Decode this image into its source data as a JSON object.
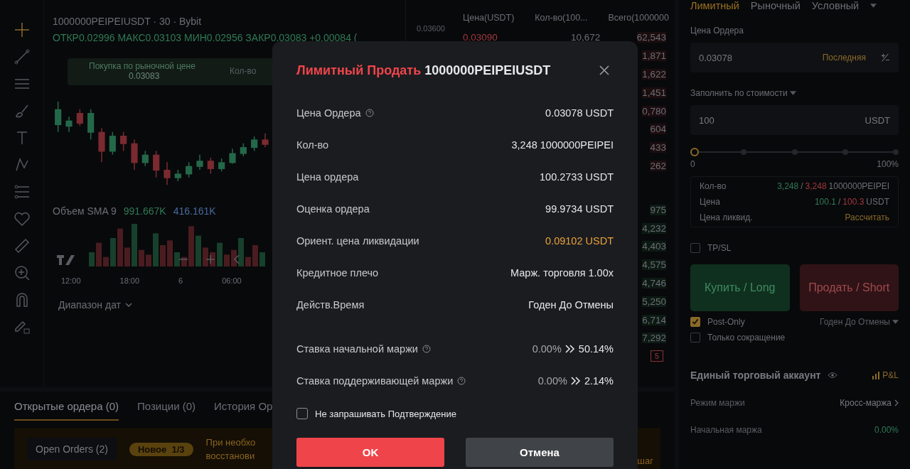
{
  "chart": {
    "legend_title": "1000000PEIPEIUSDT · 30 · Bybit",
    "ohlc": "ОТКР0.02996  МАКС0.03103  МИН0.02956  ЗАКР0.03083  +0.00084 (",
    "tooltip": {
      "label": "Покупка по рыночной цене",
      "price": "0.03083",
      "qty_label": "Кол-во"
    },
    "price_label": "0.03600",
    "volume_label": "Объем SMA 9",
    "volume_values": [
      "991.667K",
      "416.161K"
    ],
    "time_labels": [
      "12:00",
      "18:00",
      "6",
      "06:00"
    ],
    "date_range": "Диапазон дат"
  },
  "orderbook": {
    "columns": [
      "Цена(USDT)",
      "Кол-во(100...",
      "Всего(1000000"
    ],
    "rows": [
      {
        "kind": "ask",
        "price": "0.03090",
        "qty": "10,672",
        "total": "62,543"
      },
      {
        "kind": "ask",
        "total": "1,871"
      },
      {
        "kind": "ask",
        "total": "1,622"
      },
      {
        "kind": "ask",
        "total": "1,451"
      },
      {
        "kind": "ask",
        "total": "0,780"
      },
      {
        "kind": "ask",
        "total": "604"
      },
      {
        "kind": "ask",
        "total": "433"
      },
      {
        "kind": "ask",
        "total": "262"
      },
      {
        "kind": "bid",
        "total": "975"
      },
      {
        "kind": "bid",
        "total": "4,232"
      },
      {
        "kind": "bid",
        "total": "4,403"
      },
      {
        "kind": "bid",
        "total": "4,575"
      },
      {
        "kind": "bid",
        "total": "4,746"
      },
      {
        "kind": "bid",
        "total": "5,250"
      },
      {
        "kind": "bid",
        "total": "6,714"
      },
      {
        "kind": "bid",
        "total": "7,292"
      }
    ],
    "footer_badge": "5"
  },
  "bottom": {
    "tabs": [
      {
        "label": "Открытые ордера (0)",
        "selected": true
      },
      {
        "label": "Позиции (0)",
        "selected": false
      },
      {
        "label": "История Ор",
        "selected": false
      }
    ],
    "banner": {
      "chip": "Open Orders (2)",
      "badge": "Новое  1/3",
      "lines": [
        "При необхо",
        "восстанови"
      ],
      "tail": "шаг"
    }
  },
  "order_form": {
    "tabs": [
      {
        "label": "Лимитный",
        "selected": true
      },
      {
        "label": "Рыночный",
        "selected": false
      },
      {
        "label": "Условный",
        "selected": false
      }
    ],
    "price_label": "Цена Ордера",
    "price_value": "0.03078",
    "price_hint": "Последняя",
    "amount_label": "Заполнить по стоимости",
    "amount_value": "100",
    "amount_unit": "USDT",
    "slider": {
      "level": 0,
      "min_label": "0",
      "max_label": "100%"
    },
    "summary": [
      {
        "label": "Кол-во",
        "buy": "3,248",
        "separator": "/",
        "sell": "3,248",
        "unit": "1000000PEIPEI"
      },
      {
        "label": "Цена",
        "buy": "100.1",
        "separator": "/",
        "sell": "100.3",
        "unit": "USDT"
      },
      {
        "label": "Цена ликвид.",
        "action": "Рассчитать"
      }
    ],
    "tpsl": {
      "label": "TP/SL",
      "checked": false
    },
    "buy_button": "Купить / Long",
    "sell_button": "Продать / Short",
    "options": [
      {
        "label": "Post-Only",
        "checked": true
      },
      {
        "label": "Только сокращение",
        "checked": false
      }
    ],
    "tif": "Годен До Отмены",
    "account": {
      "title": "Единый торговый аккаунт",
      "pnl": "P&L",
      "rows": [
        {
          "label": "Режим маржи",
          "value": "Кросс-маржа"
        },
        {
          "label": "Начальная маржа",
          "value": "0.00%"
        }
      ]
    }
  },
  "modal": {
    "title_action": "Лимитный Продать",
    "title_symbol": "1000000PEIPEIUSDT",
    "rows": [
      {
        "label": "Цена Ордера",
        "help": true,
        "value": "0.03078 USDT",
        "highlight": false
      },
      {
        "label": "Кол-во",
        "help": false,
        "value": "3,248 1000000PEIPEI",
        "highlight": false
      },
      {
        "label": "Цена ордера",
        "help": false,
        "value": "100.2733 USDT",
        "highlight": false
      },
      {
        "label": "Оценка ордера",
        "help": false,
        "value": "99.9734 USDT",
        "highlight": false
      },
      {
        "label": "Ориент. цена ликвидации",
        "help": false,
        "value": "0.09102 USDT",
        "highlight": true
      },
      {
        "label": "Кредитное плечо",
        "help": false,
        "value": "Марж. торговля 1.00x",
        "highlight": false
      },
      {
        "label": "Действ.Время",
        "help": false,
        "value": "Годен До Отмены",
        "highlight": false
      }
    ],
    "margin_rows": [
      {
        "label": "Ставка начальной маржи",
        "help": true,
        "from": "0.00%",
        "to": "50.14%"
      },
      {
        "label": "Ставка поддерживающей маржи",
        "help": true,
        "from": "0.00%",
        "to": "2.14%"
      }
    ],
    "no_confirm": {
      "label": "Не запрашивать Подтверждение",
      "checked": false
    },
    "ok": "OK",
    "cancel": "Отмена"
  }
}
